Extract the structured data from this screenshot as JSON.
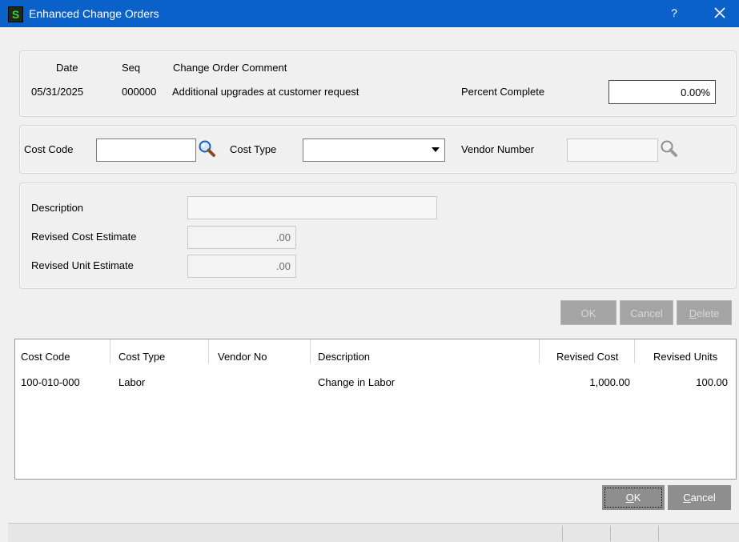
{
  "window": {
    "title": "Enhanced Change Orders",
    "app_icon_letter": "S",
    "help_label": "?"
  },
  "header": {
    "date_label": "Date",
    "seq_label": "Seq",
    "comment_label": "Change Order Comment",
    "date_value": "05/31/2025",
    "seq_value": "000000",
    "comment_value": "Additional upgrades at customer request",
    "percent_label": "Percent Complete",
    "percent_value": "0.00%"
  },
  "filters": {
    "cost_code_label": "Cost Code",
    "cost_code_value": "",
    "cost_type_label": "Cost Type",
    "cost_type_value": "",
    "vendor_label": "Vendor Number",
    "vendor_value": ""
  },
  "detail": {
    "description_label": "Description",
    "description_value": "",
    "revised_cost_label": "Revised Cost Estimate",
    "revised_cost_value": ".00",
    "revised_unit_label": "Revised Unit Estimate",
    "revised_unit_value": ".00"
  },
  "line_buttons": {
    "ok": "OK",
    "cancel": "Cancel",
    "delete": "Delete"
  },
  "grid": {
    "columns": [
      "Cost Code",
      "Cost Type",
      "Vendor No",
      "Description",
      "Revised Cost",
      "Revised Units"
    ],
    "rows": [
      [
        "100-010-000",
        "Labor",
        "",
        "Change in Labor",
        "1,000.00",
        "100.00"
      ]
    ]
  },
  "footer": {
    "ok": "OK",
    "cancel": "Cancel"
  },
  "colors": {
    "titlebar": "#0a61c9",
    "accent_button": "#8e8e8e"
  }
}
